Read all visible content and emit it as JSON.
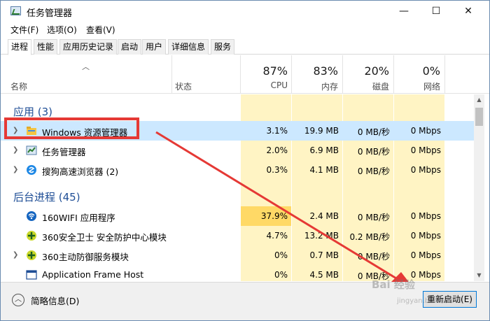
{
  "window": {
    "title": "任务管理器",
    "minimize": "—",
    "maximize": "☐",
    "close": "✕"
  },
  "menu": [
    "文件(F)",
    "选项(O)",
    "查看(V)"
  ],
  "tabs": [
    "进程",
    "性能",
    "应用历史记录",
    "启动",
    "用户",
    "详细信息",
    "服务"
  ],
  "header": {
    "name": "名称",
    "status": "状态",
    "cpu": {
      "pct": "87%",
      "label": "CPU"
    },
    "memory": {
      "pct": "83%",
      "label": "内存"
    },
    "disk": {
      "pct": "20%",
      "label": "磁盘"
    },
    "network": {
      "pct": "0%",
      "label": "网络"
    }
  },
  "groups": {
    "apps": "应用 (3)",
    "background": "后台进程 (45)"
  },
  "rows": [
    {
      "name": "Windows 资源管理器",
      "cpu": "3.1%",
      "mem": "19.9 MB",
      "disk": "0 MB/秒",
      "net": "0 Mbps",
      "icon": "folder-icon"
    },
    {
      "name": "任务管理器",
      "cpu": "2.0%",
      "mem": "6.9 MB",
      "disk": "0 MB/秒",
      "net": "0 Mbps",
      "icon": "task-manager-icon"
    },
    {
      "name": "搜狗高速浏览器 (2)",
      "cpu": "0.3%",
      "mem": "4.1 MB",
      "disk": "0 MB/秒",
      "net": "0 Mbps",
      "icon": "sogou-browser-icon"
    },
    {
      "name": "160WIFI 应用程序",
      "cpu": "37.9%",
      "mem": "2.4 MB",
      "disk": "0 MB/秒",
      "net": "0 Mbps",
      "icon": "wifi-icon"
    },
    {
      "name": "360安全卫士 安全防护中心模块",
      "cpu": "4.7%",
      "mem": "13.2 MB",
      "disk": "0.2 MB/秒",
      "net": "0 Mbps",
      "icon": "360-icon"
    },
    {
      "name": "360主动防御服务模块",
      "cpu": "0%",
      "mem": "0.7 MB",
      "disk": "0 MB/秒",
      "net": "0 Mbps",
      "icon": "360-icon"
    },
    {
      "name": "Application Frame Host",
      "cpu": "0%",
      "mem": "4.5 MB",
      "disk": "0 MB/秒",
      "net": "0 Mbps",
      "icon": "app-frame-icon"
    }
  ],
  "footer": {
    "fewer": "简略信息(D)",
    "restart": "重新启动(E)"
  },
  "watermark": {
    "text": "Bai 经验",
    "sub": "jingyan.baidu.com"
  }
}
